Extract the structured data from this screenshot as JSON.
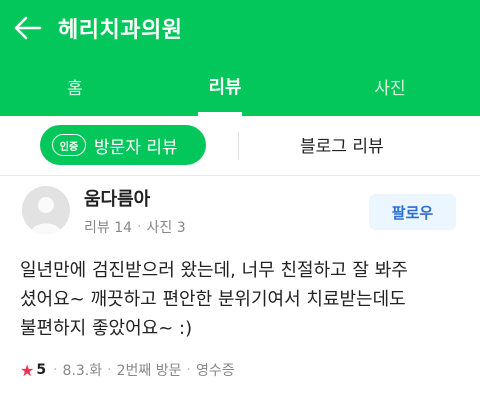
{
  "header": {
    "title": "헤리치과의원",
    "back_icon": "arrow-left-icon"
  },
  "tabs": [
    {
      "label": "홈"
    },
    {
      "label": "리뷰"
    },
    {
      "label": "사진"
    }
  ],
  "subtabs": {
    "badge": "인증",
    "visitor_review": "방문자 리뷰",
    "blog_review": "블로그 리뷰"
  },
  "review": {
    "user": "움다름아",
    "reviews": "리뷰 14",
    "photos": "사진 3",
    "follow": "팔로우",
    "lines": [
      "일년만에 검진받으러 왔는데, 너무 친절하고 잘 봐주",
      "셨어요~ 깨끗하고 편안한 분위기여서 치료받는데도",
      "불편하지 좋았어요~ :)"
    ],
    "star": "★",
    "rating": "5",
    "date": "8.3.화",
    "visit": "2번째 방문",
    "receipt": "영수증"
  },
  "colors": {
    "brand": "#03c75a",
    "star": "#f0344e",
    "follow_text": "#2b6fd4"
  }
}
